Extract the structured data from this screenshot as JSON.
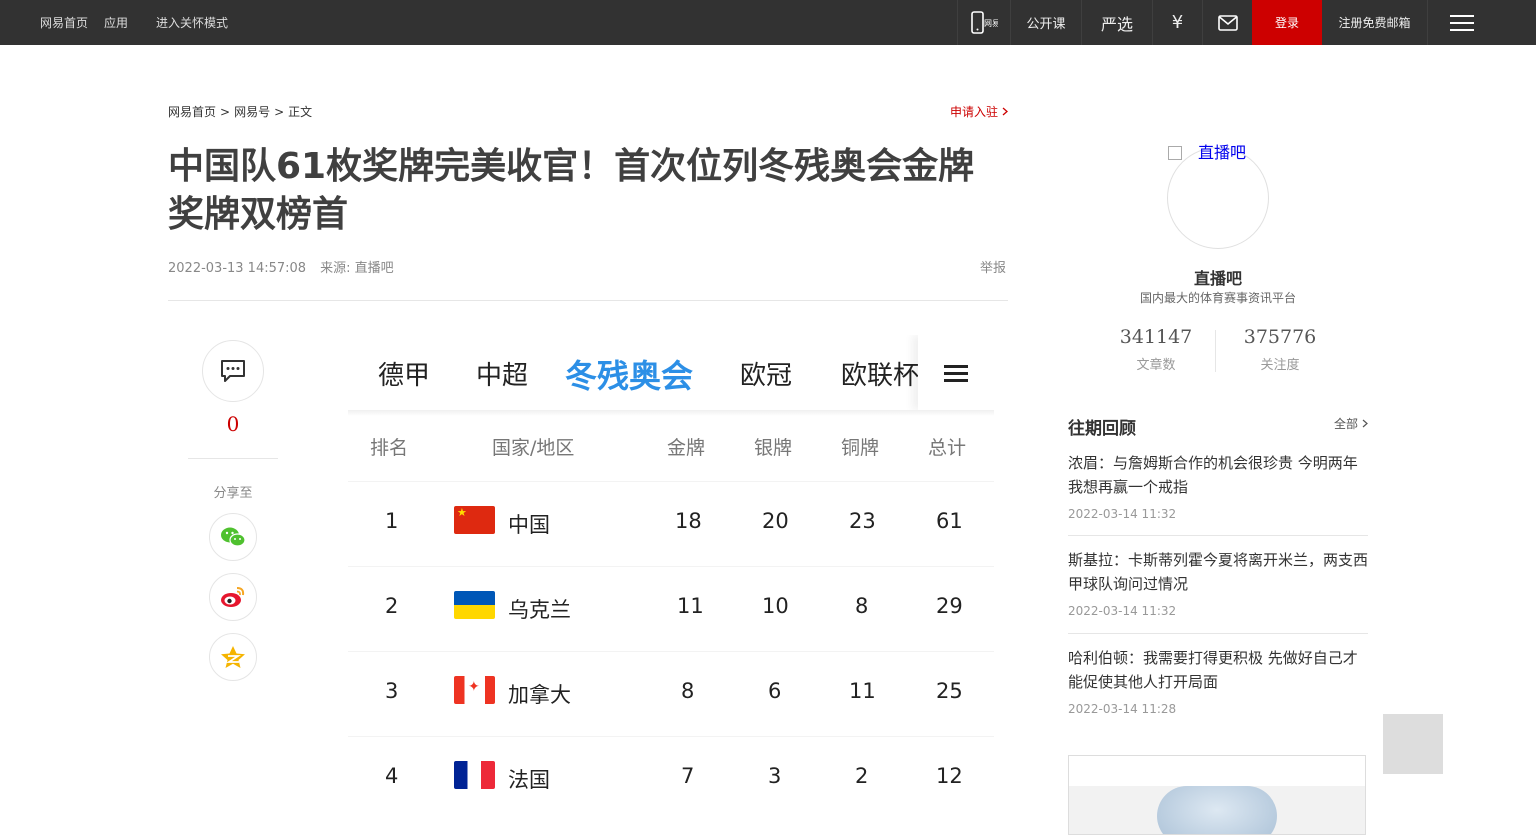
{
  "topbar": {
    "left_links": [
      "网易首页",
      "应用"
    ],
    "care_mode": "进入关怀模式",
    "app_icon_label": "网易",
    "open_course": "公开课",
    "yanxuan": "严选",
    "yen": "¥",
    "login": "登录",
    "register": "注册免费邮箱"
  },
  "breadcrumb": {
    "home": "网易首页",
    "sep": ">",
    "section": "网易号",
    "current": "正文"
  },
  "apply_link": "申请入驻",
  "article": {
    "title": "中国队61枚奖牌完美收官！首次位列冬残奥会金牌奖牌双榜首",
    "datetime": "2022-03-13 14:57:08",
    "source": "来源: 直播吧",
    "report": "举报"
  },
  "tools": {
    "comment_count": "0",
    "share_label": "分享至"
  },
  "medal_image": {
    "tabs": [
      "德甲",
      "中超",
      "冬残奥会",
      "欧冠",
      "欧联杯"
    ],
    "active_tab": "冬残奥会",
    "headers": [
      "排名",
      "国家/地区",
      "金牌",
      "银牌",
      "铜牌",
      "总计"
    ],
    "rows": [
      {
        "rank": "1",
        "country": "中国",
        "flag": "china-flag",
        "gold": "18",
        "silver": "20",
        "bronze": "23",
        "total": "61"
      },
      {
        "rank": "2",
        "country": "乌克兰",
        "flag": "ukraine-flag",
        "gold": "11",
        "silver": "10",
        "bronze": "8",
        "total": "29"
      },
      {
        "rank": "3",
        "country": "加拿大",
        "flag": "canada-flag",
        "gold": "8",
        "silver": "6",
        "bronze": "11",
        "total": "25"
      },
      {
        "rank": "4",
        "country": "法国",
        "flag": "france-flag",
        "gold": "7",
        "silver": "3",
        "bronze": "2",
        "total": "12"
      }
    ]
  },
  "sidebar": {
    "avatar_alt": "直播吧",
    "author": "直播吧",
    "author_desc": "国内最大的体育赛事资讯平台",
    "stats": [
      {
        "value": "341147",
        "label": "文章数"
      },
      {
        "value": "375776",
        "label": "关注度"
      }
    ],
    "section_title": "往期回顾",
    "section_more": "全部",
    "news": [
      {
        "title": "浓眉：与詹姆斯合作的机会很珍贵 今明两年我想再赢一个戒指",
        "date": "2022-03-14 11:32"
      },
      {
        "title": "斯基拉：卡斯蒂列霍今夏将离开米兰，两支西甲球队询问过情况",
        "date": "2022-03-14 11:32"
      },
      {
        "title": "哈利伯顿：我需要打得更积极 先做好自己才能促使其他人打开局面",
        "date": "2022-03-14 11:28"
      }
    ]
  },
  "colors": {
    "topbar_bg": "#323232",
    "login_bg": "#cd0000",
    "accent_red": "#cc0000",
    "active_tab": "#2c8fe6"
  }
}
